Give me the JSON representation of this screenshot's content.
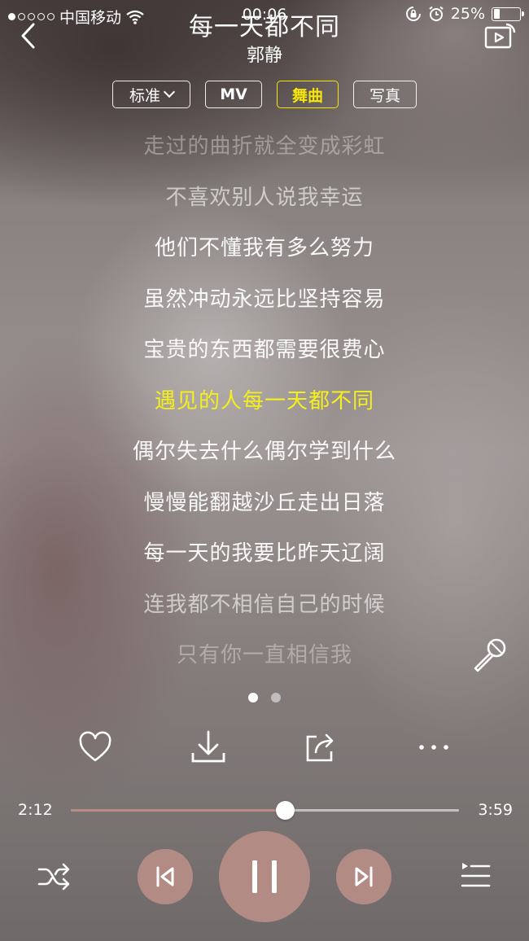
{
  "status_bar": {
    "signal_dots_filled": 1,
    "signal_dots_total": 5,
    "carrier": "中国移动",
    "time": "00:06",
    "battery": "25%",
    "battery_level": 0.25
  },
  "header": {
    "title": "每一天都不同",
    "artist": "郭静"
  },
  "tabs": [
    {
      "label": "标准"
    },
    {
      "label": "MV"
    },
    {
      "label": "舞曲",
      "active": true
    },
    {
      "label": "写真"
    }
  ],
  "lyrics": {
    "current_index": 5,
    "lines": [
      "走过的曲折就全变成彩虹",
      "不喜欢别人说我幸运",
      "他们不懂我有多么努力",
      "虽然冲动永远比坚持容易",
      "宝贵的东西都需要很费心",
      "遇见的人每一天都不同",
      "偶尔失去什么偶尔学到什么",
      "慢慢能翻越沙丘走出日落",
      "每一天的我要比昨天辽阔",
      "连我都不相信自己的时候",
      "只有你一直相信我"
    ]
  },
  "pager": {
    "pages": 2,
    "active": 0
  },
  "progress": {
    "current": "2:12",
    "total": "3:59",
    "fraction": 0.552
  },
  "colors": {
    "accent_yellow": "#f5ef1b",
    "control_fill": "#b38b85",
    "progress_played": "#b98c86"
  },
  "icons": {
    "back": "chevron-left-icon",
    "cast": "screen-cast-icon",
    "mic": "microphone-icon",
    "like": "heart-icon",
    "download": "download-icon",
    "share": "share-icon",
    "more": "more-icon",
    "shuffle": "shuffle-icon",
    "prev": "previous-icon",
    "pause": "pause-icon",
    "next": "next-icon",
    "queue": "playlist-icon"
  }
}
